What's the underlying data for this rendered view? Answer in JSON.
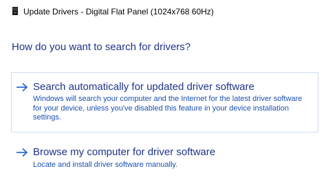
{
  "window": {
    "title": "Update Drivers - Digital Flat Panel (1024x768 60Hz)",
    "icon": "monitor-device-icon"
  },
  "heading": "How do you want to search for drivers?",
  "options": [
    {
      "title": "Search automatically for updated driver software",
      "description_lines": [
        "Windows will search your computer and the Internet for the latest driver software",
        "for your device, unless you've disabled this feature in your device installation",
        "settings."
      ],
      "icon": "arrow-right-icon",
      "highlighted": true
    },
    {
      "title": "Browse my computer for driver software",
      "description_lines": [
        "Locate and install driver software manually."
      ],
      "icon": "arrow-right-icon",
      "highlighted": false
    }
  ],
  "colors": {
    "heading": "#1e3287",
    "link": "#1e3287",
    "description": "#1a4fb0",
    "highlight_border": "#cfdaf0",
    "arrow": "#1e5bd6"
  }
}
